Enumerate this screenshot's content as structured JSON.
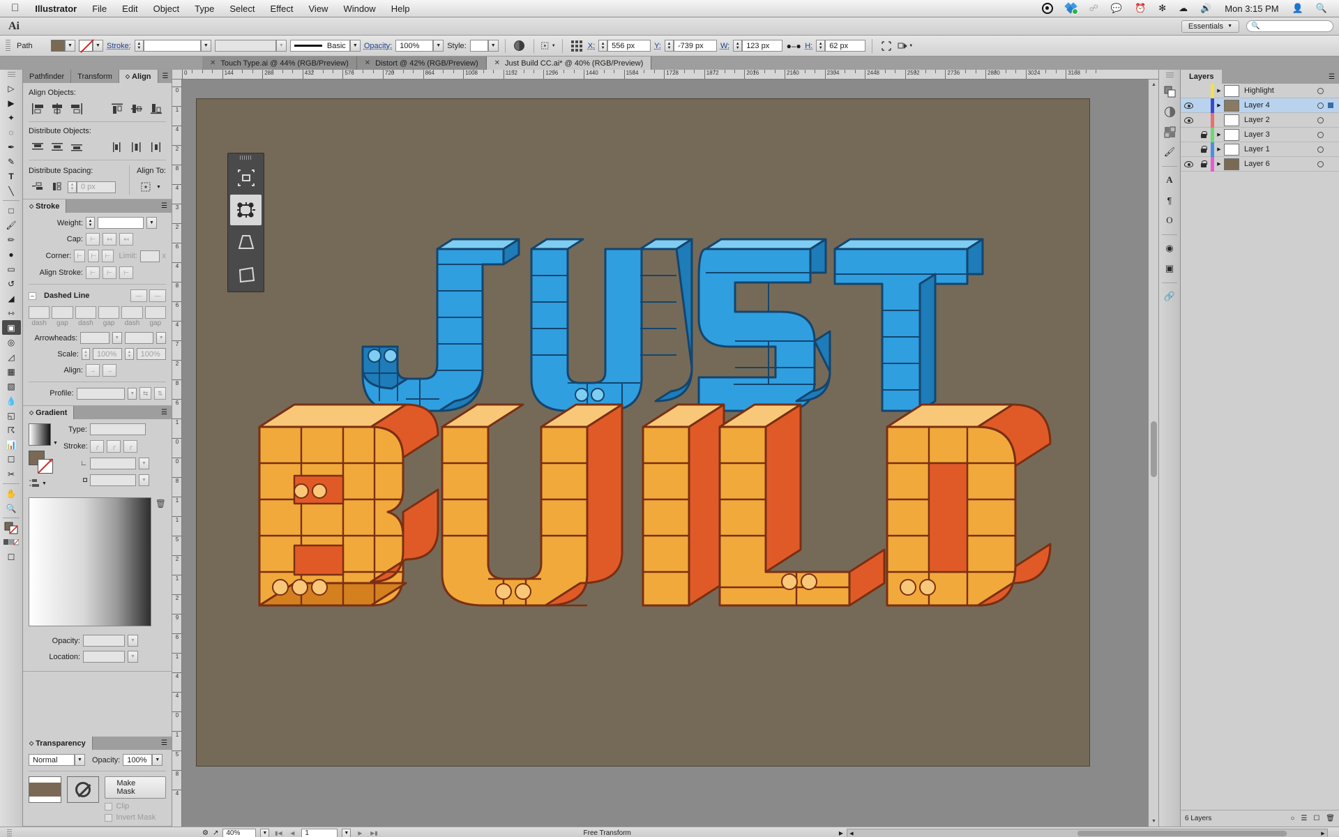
{
  "menubar": {
    "apple": "",
    "items": [
      "Illustrator",
      "File",
      "Edit",
      "Object",
      "Type",
      "Select",
      "Effect",
      "View",
      "Window",
      "Help"
    ],
    "clock": "Mon 3:15 PM",
    "icons": [
      "creative-cloud-icon",
      "dropbox-icon",
      "bluetooth-icon",
      "messages-icon",
      "timemachine-icon",
      "airplay-icon",
      "wifi-icon",
      "volume-icon",
      "user-icon",
      "spotlight-icon"
    ]
  },
  "appbar": {
    "logo": "Ai",
    "workspace": "Essentials",
    "search_placeholder": ""
  },
  "options": {
    "object_type": "Path",
    "fill_color": "#7a6a55",
    "stroke_label": "Stroke:",
    "stroke_weight": "",
    "stroke_variable": "",
    "brush_def": "Basic",
    "opacity_label": "Opacity:",
    "opacity_value": "100%",
    "style_label": "Style:",
    "style_value": "",
    "x_label": "X:",
    "x_value": "556 px",
    "y_label": "Y:",
    "y_value": "-739 px",
    "w_label": "W:",
    "w_value": "123 px",
    "h_label": "H:",
    "h_value": "62 px"
  },
  "tabs": [
    {
      "title": "Touch Type.ai @ 44% (RGB/Preview)",
      "active": false
    },
    {
      "title": "Distort @ 42% (RGB/Preview)",
      "active": false
    },
    {
      "title": "Just Build CC.ai* @ 40% (RGB/Preview)",
      "active": true
    }
  ],
  "toolbar": {
    "tools": [
      "selection-tool",
      "direct-selection-tool",
      "magic-wand-tool",
      "lasso-tool",
      "pen-tool",
      "add-anchor-tool",
      "type-tool",
      "line-tool",
      "rectangle-tool",
      "paintbrush-tool",
      "pencil-tool",
      "blob-brush-tool",
      "eraser-tool",
      "rotate-tool",
      "scale-tool",
      "width-tool",
      "free-transform-tool",
      "shape-builder-tool",
      "perspective-grid-tool",
      "mesh-tool",
      "gradient-tool",
      "eyedropper-tool",
      "blend-tool",
      "symbol-sprayer-tool",
      "column-graph-tool",
      "artboard-tool",
      "slice-tool",
      "hand-tool",
      "zoom-tool"
    ],
    "selected_tool": "free-transform-tool"
  },
  "touch_type_bar": {
    "items": [
      "constrain-icon",
      "free-transform-icon",
      "perspective-distort-icon",
      "free-distort-icon"
    ],
    "selected": "free-transform-icon"
  },
  "align_panel": {
    "tabs": [
      "Pathfinder",
      "Transform",
      "Align"
    ],
    "active_tab": "Align",
    "align_objects_label": "Align Objects:",
    "distribute_objects_label": "Distribute Objects:",
    "distribute_spacing_label": "Distribute Spacing:",
    "spacing_value": "0 px",
    "align_to_label": "Align To:",
    "align_buttons": [
      "align-left-icon",
      "align-horizontal-center-icon",
      "align-right-icon",
      "align-top-icon",
      "align-vertical-center-icon",
      "align-bottom-icon"
    ],
    "distribute_buttons": [
      "distribute-top-icon",
      "distribute-vertical-center-icon",
      "distribute-bottom-icon",
      "distribute-left-icon",
      "distribute-horizontal-center-icon",
      "distribute-right-icon"
    ],
    "spacing_buttons": [
      "distribute-vertical-space-icon",
      "distribute-horizontal-space-icon"
    ]
  },
  "stroke_panel": {
    "title": "Stroke",
    "weight_label": "Weight:",
    "weight_value": "",
    "cap_label": "Cap:",
    "corner_label": "Corner:",
    "limit_label": "Limit:",
    "limit_value": "",
    "limit_unit": "x",
    "align_stroke_label": "Align Stroke:",
    "dashed_line_label": "Dashed Line",
    "dash_labels": [
      "dash",
      "gap",
      "dash",
      "gap",
      "dash",
      "gap"
    ],
    "arrowheads_label": "Arrowheads:",
    "scale_label": "Scale:",
    "scale_value_1": "100%",
    "scale_value_2": "100%",
    "align_label": "Align:",
    "profile_label": "Profile:",
    "profile_value": ""
  },
  "gradient_panel": {
    "title": "Gradient",
    "type_label": "Type:",
    "type_value": "",
    "stroke_label": "Stroke:",
    "angle_value": "",
    "aspect_value": "",
    "opacity_label": "Opacity:",
    "opacity_value": "",
    "location_label": "Location:",
    "location_value": "",
    "fill_swatch": "#7a6a55"
  },
  "transparency_panel": {
    "title": "Transparency",
    "blend_mode": "Normal",
    "opacity_label": "Opacity:",
    "opacity_value": "100%",
    "make_mask_label": "Make Mask",
    "clip_label": "Clip",
    "invert_mask_label": "Invert Mask",
    "thumb_color": "#7a6a55"
  },
  "layers_panel": {
    "title": "Layers",
    "columns": [
      "visibility",
      "lock",
      "color",
      "expand",
      "thumbnail",
      "name",
      "target"
    ],
    "rows": [
      {
        "name": "Highlight",
        "visible": false,
        "locked": false,
        "color": "#f2e24a",
        "selected": false,
        "has_children": true,
        "thumb": "#ffffff"
      },
      {
        "name": "Layer 4",
        "visible": true,
        "locked": false,
        "color": "#3a47d5",
        "selected": true,
        "has_children": true,
        "thumb": "#8a7a62"
      },
      {
        "name": "Layer 2",
        "visible": true,
        "locked": false,
        "color": "#ef6d6d",
        "selected": false,
        "has_children": false,
        "thumb": "#ffffff"
      },
      {
        "name": "Layer 3",
        "visible": false,
        "locked": true,
        "color": "#6ed96e",
        "selected": false,
        "has_children": true,
        "thumb": "#ffffff"
      },
      {
        "name": "Layer 1",
        "visible": false,
        "locked": true,
        "color": "#4a8fe0",
        "selected": false,
        "has_children": true,
        "thumb": "#ffffff"
      },
      {
        "name": "Layer 6",
        "visible": true,
        "locked": true,
        "color": "#e85ad6",
        "selected": false,
        "has_children": true,
        "thumb": "#7a6a55"
      }
    ],
    "footer_count": "6 Layers",
    "footer_icons": [
      "make-clipping-mask-icon",
      "create-sublayer-icon",
      "new-layer-icon",
      "delete-layer-icon"
    ]
  },
  "right_dock": {
    "icons": [
      "color-icon",
      "color-guide-icon",
      "swatches-icon",
      "brushes-icon",
      "symbols-icon",
      "paragraph-styles-icon",
      "character-styles-icon",
      "appearance-icon",
      "graphic-styles-icon",
      "links-icon",
      "artboards-icon"
    ]
  },
  "rulers": {
    "h_ticks": [
      "0",
      "144",
      "288",
      "432",
      "576",
      "720",
      "864",
      "1008",
      "1152",
      "1296",
      "1440",
      "1584",
      "1728",
      "1872",
      "2016",
      "2160",
      "2304",
      "2448",
      "2592",
      "2736",
      "2880",
      "3024",
      "3168"
    ],
    "v_ticks": [
      "0",
      "1",
      "4",
      "2",
      "8",
      "4",
      "3",
      "2",
      "6",
      "4",
      "8",
      "6",
      "4",
      "7",
      "2",
      "8",
      "6",
      "1",
      "0",
      "0",
      "8",
      "1",
      "1",
      "5",
      "2",
      "1",
      "2",
      "9",
      "6",
      "1",
      "4",
      "4",
      "0",
      "1",
      "5",
      "8",
      "4"
    ]
  },
  "artboard": {
    "background": "#756a58",
    "word_top": "JUST",
    "word_bottom": "BUILD",
    "top_color": "#35a7e8",
    "top_shadow": "#1f6fb0",
    "bottom_color": "#f2a93b",
    "bottom_shadow": "#e05a28",
    "outline": "#2a1f14"
  },
  "status": {
    "zoom": "40%",
    "page": "1",
    "tool_status": "Free Transform"
  }
}
